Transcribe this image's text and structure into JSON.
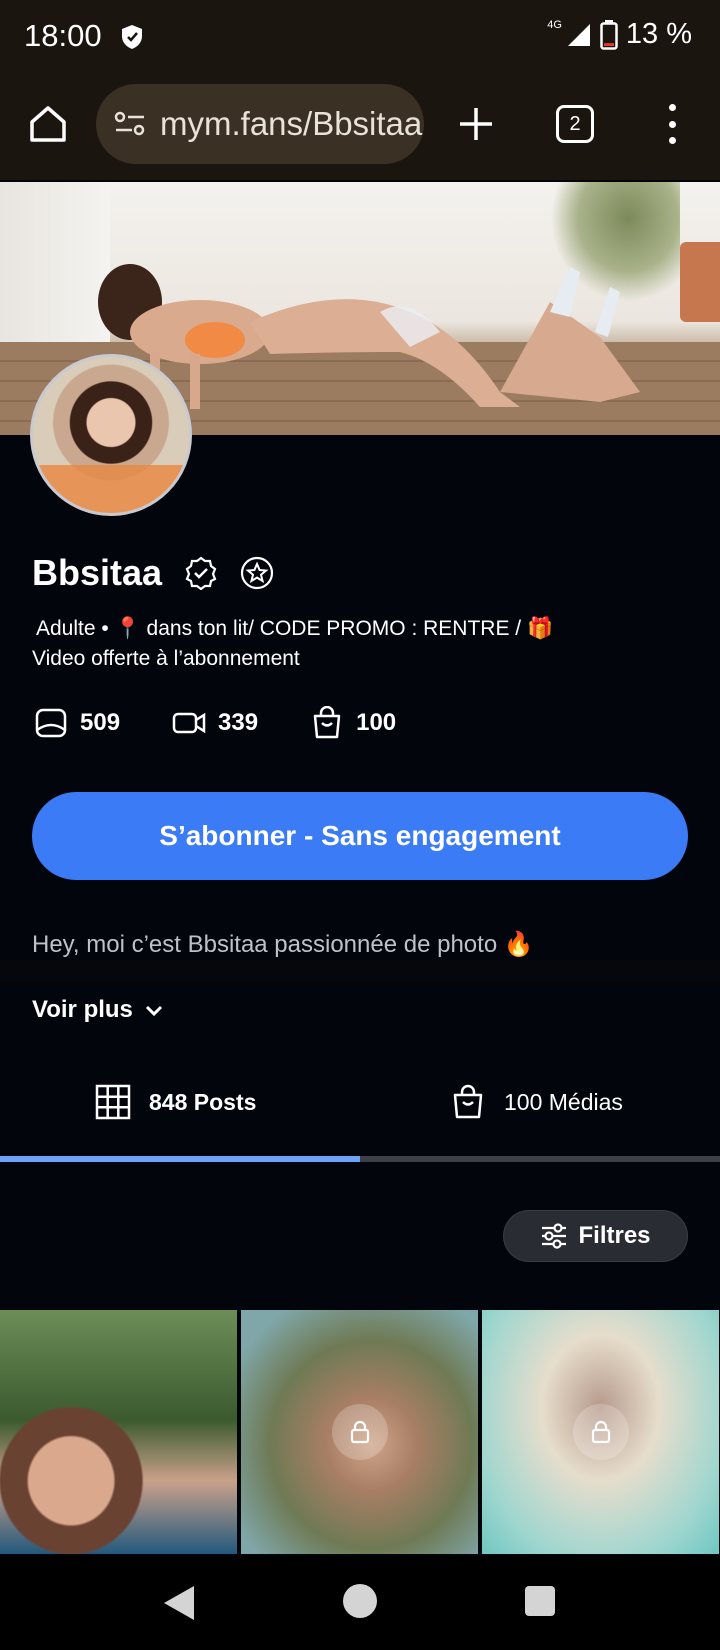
{
  "status_bar": {
    "time": "18:00",
    "network": "4G",
    "battery": "13 %",
    "battery_level_pct": 13
  },
  "browser": {
    "url": "mym.fans/Bbsitaa",
    "tab_count": "2",
    "icons": [
      "home-icon",
      "site-settings-icon",
      "plus-icon",
      "tabs-icon",
      "more-vert-icon"
    ]
  },
  "profile": {
    "name": "Bbsitaa",
    "bio_line1": "Adulte • 📍 dans ton lit/ CODE PROMO : RENTRE / 🎁",
    "bio_line2": "Video offerte à l’abonnement",
    "stats": [
      {
        "icon": "photo-icon",
        "value": "509"
      },
      {
        "icon": "video-icon",
        "value": "339"
      },
      {
        "icon": "shopping-bag-icon",
        "value": "100"
      }
    ]
  },
  "subscribe": {
    "label": "S’abonner - Sans engagement"
  },
  "about": {
    "text": "Hey, moi c’est Bbsitaa passionnée de photo 🔥",
    "more_label": "Voir plus"
  },
  "tabs": [
    {
      "label": "848 Posts",
      "icon": "grid-icon",
      "active": true
    },
    {
      "label": "100 Médias",
      "icon": "shopping-bag-icon",
      "active": false
    }
  ],
  "filters": {
    "label": "Filtres"
  },
  "colors": {
    "accent": "#3b7cf6",
    "tab_indicator": "#6ca3f6",
    "background": "#03050c",
    "browser_bar": "#1b1510"
  }
}
